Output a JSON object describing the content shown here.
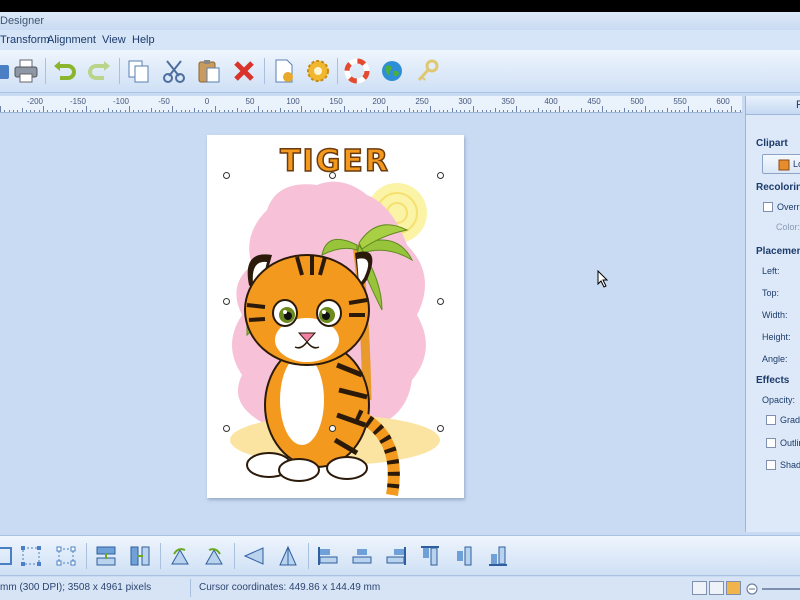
{
  "window": {
    "title": "Designer"
  },
  "menu": [
    "Transform",
    "Alignment",
    "View",
    "Help"
  ],
  "toolbar": {
    "icons": [
      "print-icon",
      "undo-icon",
      "redo-icon",
      "copy-icon",
      "cut-icon",
      "paste-icon",
      "delete-icon",
      "page-setup-icon",
      "settings-icon",
      "help-icon",
      "web-icon",
      "key-icon"
    ]
  },
  "ruler": {
    "labels": [
      "-200",
      "-150",
      "-100",
      "-50",
      "0",
      "50",
      "100",
      "150",
      "200",
      "250",
      "300",
      "350",
      "400",
      "450",
      "500",
      "550",
      "600"
    ]
  },
  "canvas": {
    "artwork_title": "TIGER"
  },
  "right_panel": {
    "header": "P",
    "clipart_heading": "Clipart",
    "load_button": "Lo",
    "recoloring_heading": "Recoloring",
    "override_label": "Overri",
    "color_label": "Color:",
    "placement_heading": "Placement",
    "left_label": "Left:",
    "top_label": "Top:",
    "width_label": "Width:",
    "height_label": "Height:",
    "angle_label": "Angle:",
    "effects_heading": "Effects",
    "opacity_label": "Opacity:",
    "gradient_label": "Gradi",
    "outline_label": "Outlin",
    "shadow_label": "Shado"
  },
  "bottom_toolbar": {
    "icons": [
      "fit-icon",
      "select-frame-icon",
      "select-group-icon",
      "flip-vertical-icon",
      "flip-horizontal-icon",
      "rotate-left-icon",
      "rotate-right-icon",
      "skew-left-icon",
      "skew-right-icon",
      "align-left-icon",
      "align-center-icon",
      "align-right-icon",
      "align-top-icon",
      "align-middle-icon",
      "align-bottom-icon"
    ]
  },
  "status": {
    "doc_info": "mm (300 DPI); 3508 x 4961 pixels",
    "cursor_coords": "Cursor coordinates: 449.86 x 144.49 mm"
  },
  "colors": {
    "accent": "#1c3b6b",
    "background": "#c9dbf3",
    "tiger_orange": "#f39a1e"
  }
}
